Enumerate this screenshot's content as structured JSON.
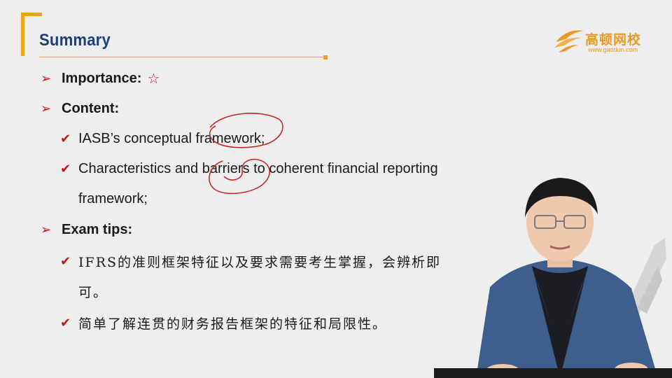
{
  "slide": {
    "title": "Summary",
    "logo": {
      "name": "高顿网校",
      "url": "www.gaodun.com"
    },
    "items": [
      {
        "label": "Importance:",
        "star": "☆"
      },
      {
        "label": "Content:"
      },
      {
        "label": "Exam tips:"
      }
    ],
    "content_points": [
      "IASB’s conceptual framework;",
      "Characteristics and barriers to coherent financial reporting",
      "framework;"
    ],
    "exam_points": [
      "IFRS的准则框架特征以及要求需要考生掌握，会辨析即",
      "可。",
      "简单了解连贯的财务报告框架的特征和局限性。"
    ]
  },
  "colors": {
    "accent": "#f0a21e",
    "title": "#1f3f7a",
    "bullet": "#c01818",
    "ink": "#c62828",
    "background": "#eeeeee"
  },
  "icons": [
    "arrow-bullet-icon",
    "check-bullet-icon",
    "star-icon",
    "gaodun-logo-icon"
  ]
}
